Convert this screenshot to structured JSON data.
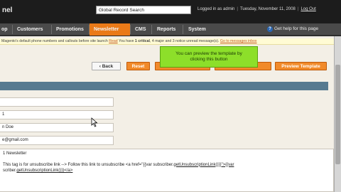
{
  "header": {
    "logo_text": "nel",
    "search_value": "Global Record Search",
    "logged_in": "Logged in as admin",
    "date": "Tuesday, November 11, 2008",
    "logout": "Log Out"
  },
  "nav": {
    "items": [
      {
        "label": "op",
        "active": false
      },
      {
        "label": "Customers",
        "active": false
      },
      {
        "label": "Promotions",
        "active": false
      },
      {
        "label": "Newsletter",
        "active": true
      },
      {
        "label": "CMS",
        "active": false
      },
      {
        "label": "Reports",
        "active": false
      },
      {
        "label": "System",
        "active": false
      }
    ],
    "help": "Get help for this page"
  },
  "notice": {
    "text": "Magento's default phone numbers and callouts before site launch",
    "link1": "Read",
    "text2": "You have",
    "critical": "1 critical",
    "text3": ", 4 major and 3 notice unread message(s).",
    "link2": "Go to messages inbox"
  },
  "buttons": {
    "back": "Back",
    "reset": "Reset",
    "preview": "Preview Template"
  },
  "tooltip": {
    "line1": "You can preview the template by",
    "line2": "clicking this button"
  },
  "form": {
    "field1": "",
    "field2": "1",
    "field3": "n Doe",
    "field4": "e@gmail.com",
    "subject": "1 Newsletter",
    "line1a": "This tag is for unsubscribe link --> Follow this link to unsubscribe <a href=\"{{var subscriber.",
    "line1b": "getUnsubscriptionLink()}}\">{{var",
    "line2a": "scriber.",
    "line2b": "getUnsubscriptionLink()}}</a>"
  },
  "colors": {
    "accent": "#ea7a18",
    "section_bar": "#577a90",
    "tooltip": "#8ddf2a"
  }
}
